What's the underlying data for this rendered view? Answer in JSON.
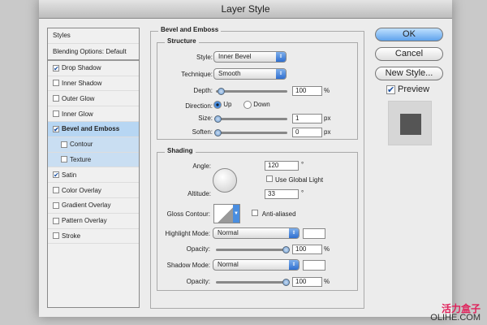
{
  "window": {
    "title": "Layer Style"
  },
  "styles_list": {
    "header": "Styles",
    "blending": "Blending Options: Default",
    "items": [
      {
        "label": "Drop Shadow",
        "checked": true
      },
      {
        "label": "Inner Shadow",
        "checked": false
      },
      {
        "label": "Outer Glow",
        "checked": false
      },
      {
        "label": "Inner Glow",
        "checked": false
      },
      {
        "label": "Bevel and Emboss",
        "checked": true,
        "selected": true
      },
      {
        "label": "Contour",
        "checked": false,
        "sub": true
      },
      {
        "label": "Texture",
        "checked": false,
        "sub": true
      },
      {
        "label": "Satin",
        "checked": true
      },
      {
        "label": "Color Overlay",
        "checked": false
      },
      {
        "label": "Gradient Overlay",
        "checked": false
      },
      {
        "label": "Pattern Overlay",
        "checked": false
      },
      {
        "label": "Stroke",
        "checked": false
      }
    ]
  },
  "bevel": {
    "title": "Bevel and Emboss",
    "structure": {
      "title": "Structure",
      "style_label": "Style:",
      "style_value": "Inner Bevel",
      "technique_label": "Technique:",
      "technique_value": "Smooth",
      "depth_label": "Depth:",
      "depth_value": "100",
      "depth_unit": "%",
      "direction_label": "Direction:",
      "up": "Up",
      "down": "Down",
      "size_label": "Size:",
      "size_value": "1",
      "size_unit": "px",
      "soften_label": "Soften:",
      "soften_value": "0",
      "soften_unit": "px"
    },
    "shading": {
      "title": "Shading",
      "angle_label": "Angle:",
      "angle_value": "120",
      "degree": "°",
      "global_light": "Use Global Light",
      "altitude_label": "Altitude:",
      "altitude_value": "33",
      "gloss_label": "Gloss Contour:",
      "anti_aliased": "Anti-aliased",
      "highlight_label": "Highlight Mode:",
      "highlight_value": "Normal",
      "opacity_label": "Opacity:",
      "highlight_opacity": "100",
      "highlight_color": "#ffffff",
      "shadow_label": "Shadow Mode:",
      "shadow_value": "Normal",
      "shadow_opacity": "100",
      "shadow_color": "#ffffff",
      "pct": "%"
    }
  },
  "buttons": {
    "ok": "OK",
    "cancel": "Cancel",
    "new_style": "New Style...",
    "preview": "Preview"
  },
  "watermark": {
    "cn": "活力盒子",
    "en": "OLIHE.COM"
  }
}
